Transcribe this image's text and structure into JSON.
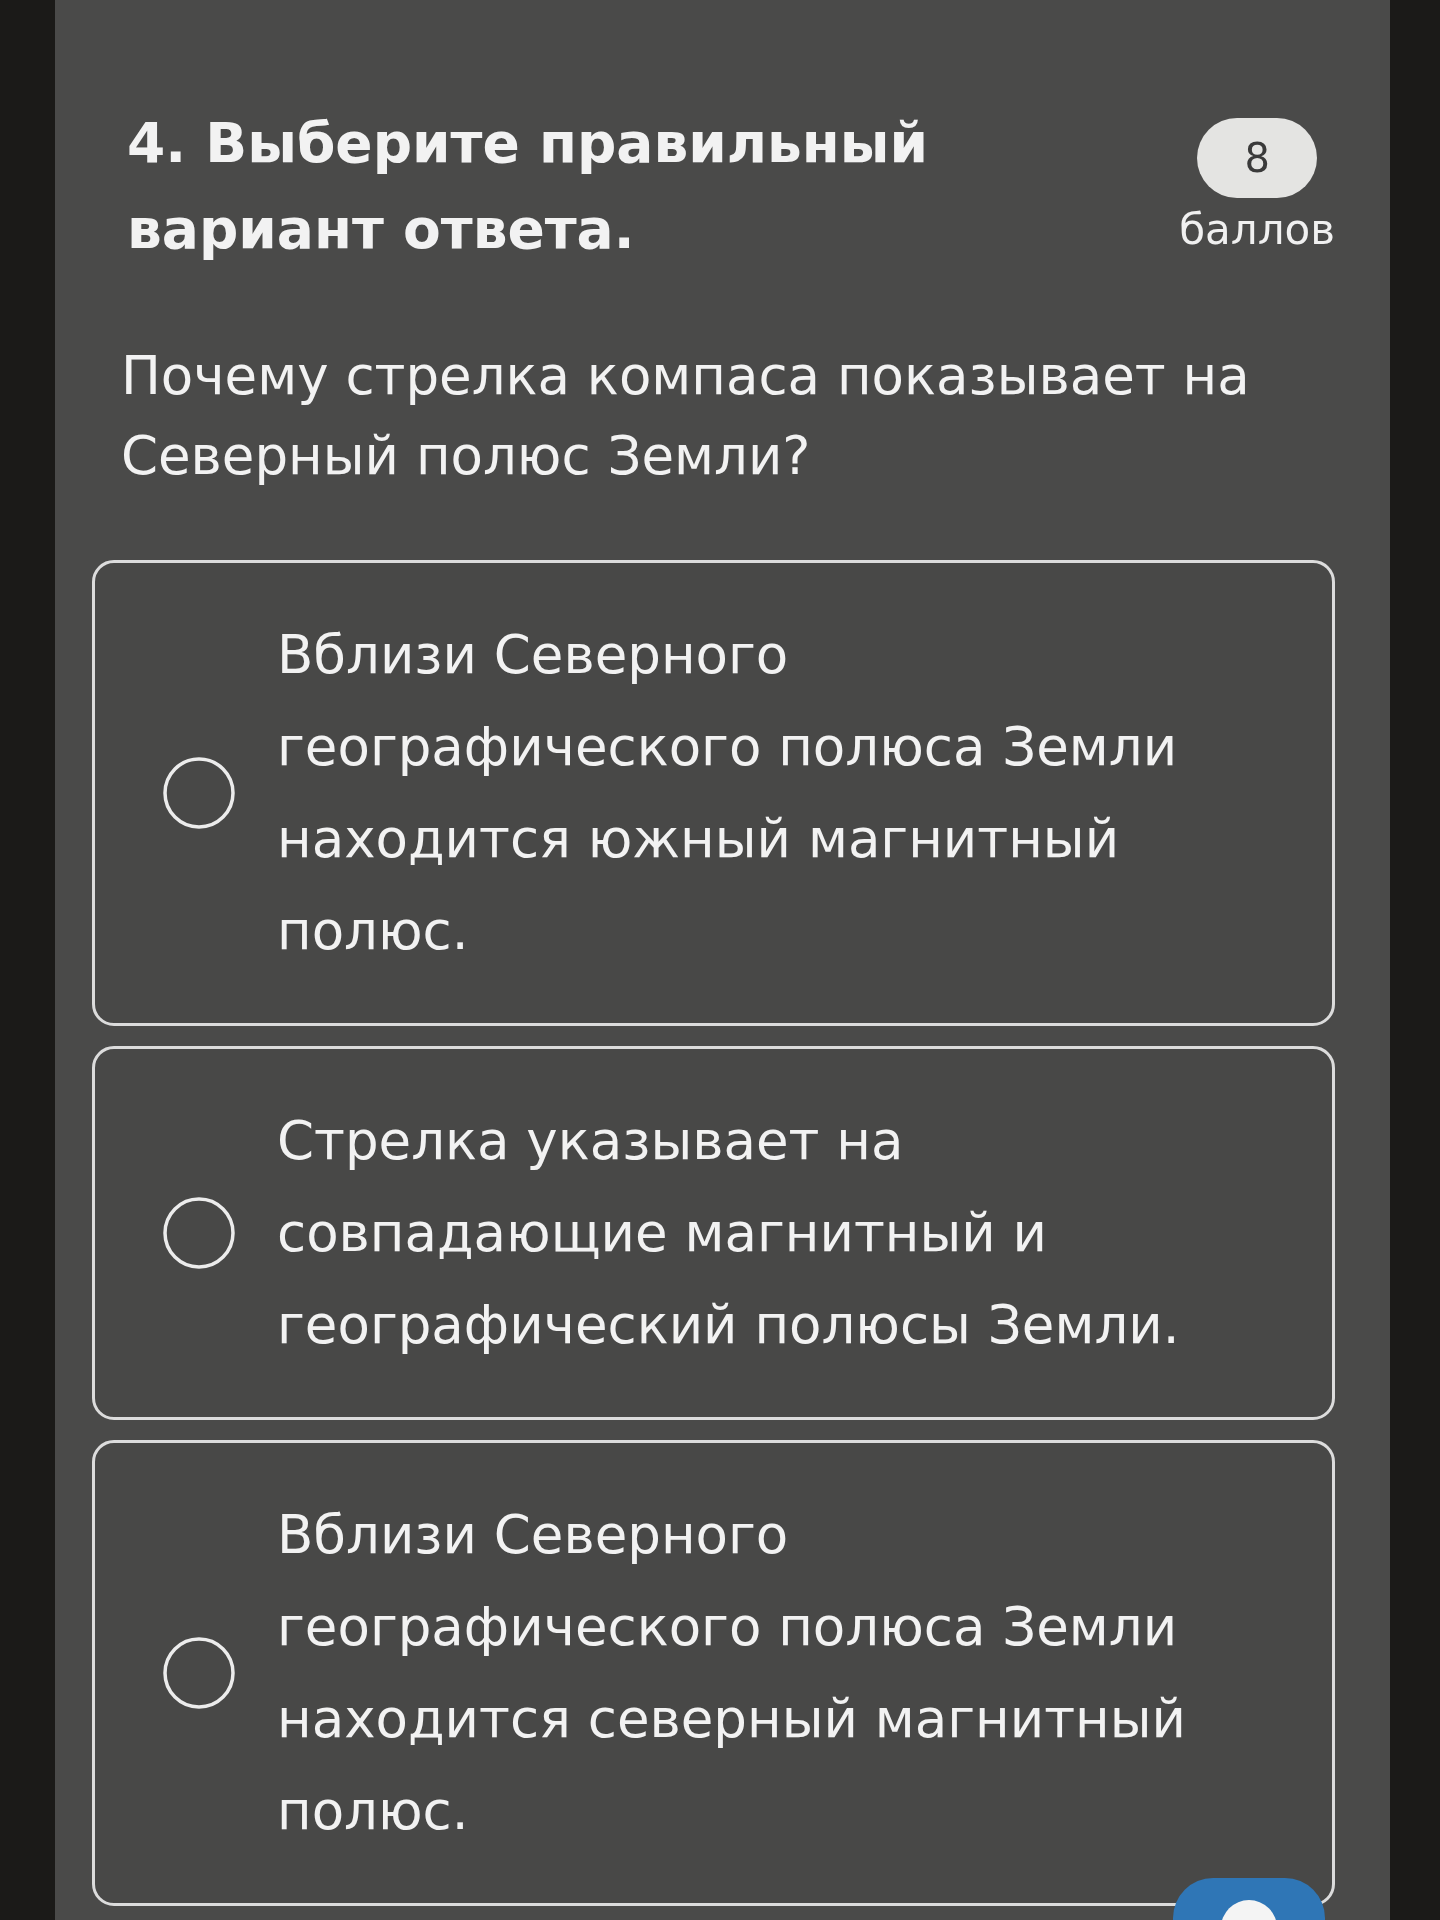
{
  "question": {
    "title": "4. Выберите правильный вариант ответа.",
    "points": "8",
    "points_label": "баллов",
    "text": "Почему стрелка компаса показывает на Северный полюс Земли?"
  },
  "options": [
    {
      "text": "Вблизи Северного географического полюса Земли находится южный магнитный полюс.",
      "selected": false
    },
    {
      "text": "Стрелка указывает на совпадающие магнитный и географический полюсы Земли.",
      "selected": false
    },
    {
      "text": "Вблизи Северного географического полюса Земли находится северный магнитный полюс.",
      "selected": false
    }
  ]
}
